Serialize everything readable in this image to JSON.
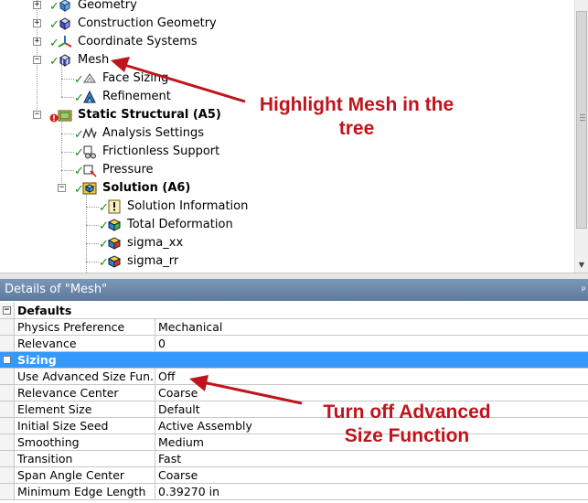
{
  "tree": {
    "items": [
      {
        "label": "Geometry",
        "bold": false
      },
      {
        "label": "Construction Geometry",
        "bold": false
      },
      {
        "label": "Coordinate Systems",
        "bold": false
      },
      {
        "label": "Mesh",
        "bold": false
      },
      {
        "label": "Face Sizing",
        "bold": false
      },
      {
        "label": "Refinement",
        "bold": false
      },
      {
        "label": "Static Structural (A5)",
        "bold": true
      },
      {
        "label": "Analysis Settings",
        "bold": false
      },
      {
        "label": "Frictionless Support",
        "bold": false
      },
      {
        "label": "Pressure",
        "bold": false
      },
      {
        "label": "Solution (A6)",
        "bold": true
      },
      {
        "label": "Solution Information",
        "bold": false
      },
      {
        "label": "Total Deformation",
        "bold": false
      },
      {
        "label": "sigma_xx",
        "bold": false
      },
      {
        "label": "sigma_rr",
        "bold": false
      }
    ]
  },
  "details": {
    "title": "Details of \"Mesh\"",
    "groups": [
      {
        "label": "Defaults",
        "rows": [
          {
            "name": "Physics Preference",
            "value": "Mechanical"
          },
          {
            "name": "Relevance",
            "value": "0"
          }
        ]
      },
      {
        "label": "Sizing",
        "rows": [
          {
            "name": "Use Advanced Size Fun...",
            "value": "Off"
          },
          {
            "name": "Relevance Center",
            "value": "Coarse"
          },
          {
            "name": "Element Size",
            "value": "Default"
          },
          {
            "name": "Initial Size Seed",
            "value": "Active Assembly"
          },
          {
            "name": "Smoothing",
            "value": "Medium"
          },
          {
            "name": "Transition",
            "value": "Fast"
          },
          {
            "name": "Span Angle Center",
            "value": "Coarse"
          },
          {
            "name": "Minimum Edge Length",
            "value": "0.39270 in"
          }
        ]
      }
    ]
  },
  "annotations": {
    "mesh_note_line1": "Highlight Mesh in the",
    "mesh_note_line2": "tree",
    "sizing_note_line1": "Turn off Advanced",
    "sizing_note_line2": "Size Function"
  },
  "colors": {
    "annotation": "#c0141c",
    "selection": "#3399ff",
    "header": "#6a87ab"
  },
  "icons": {
    "geometry": "geometry-icon",
    "mesh": "mesh-icon",
    "static_structural": "static-structural-icon",
    "solution": "solution-icon"
  }
}
